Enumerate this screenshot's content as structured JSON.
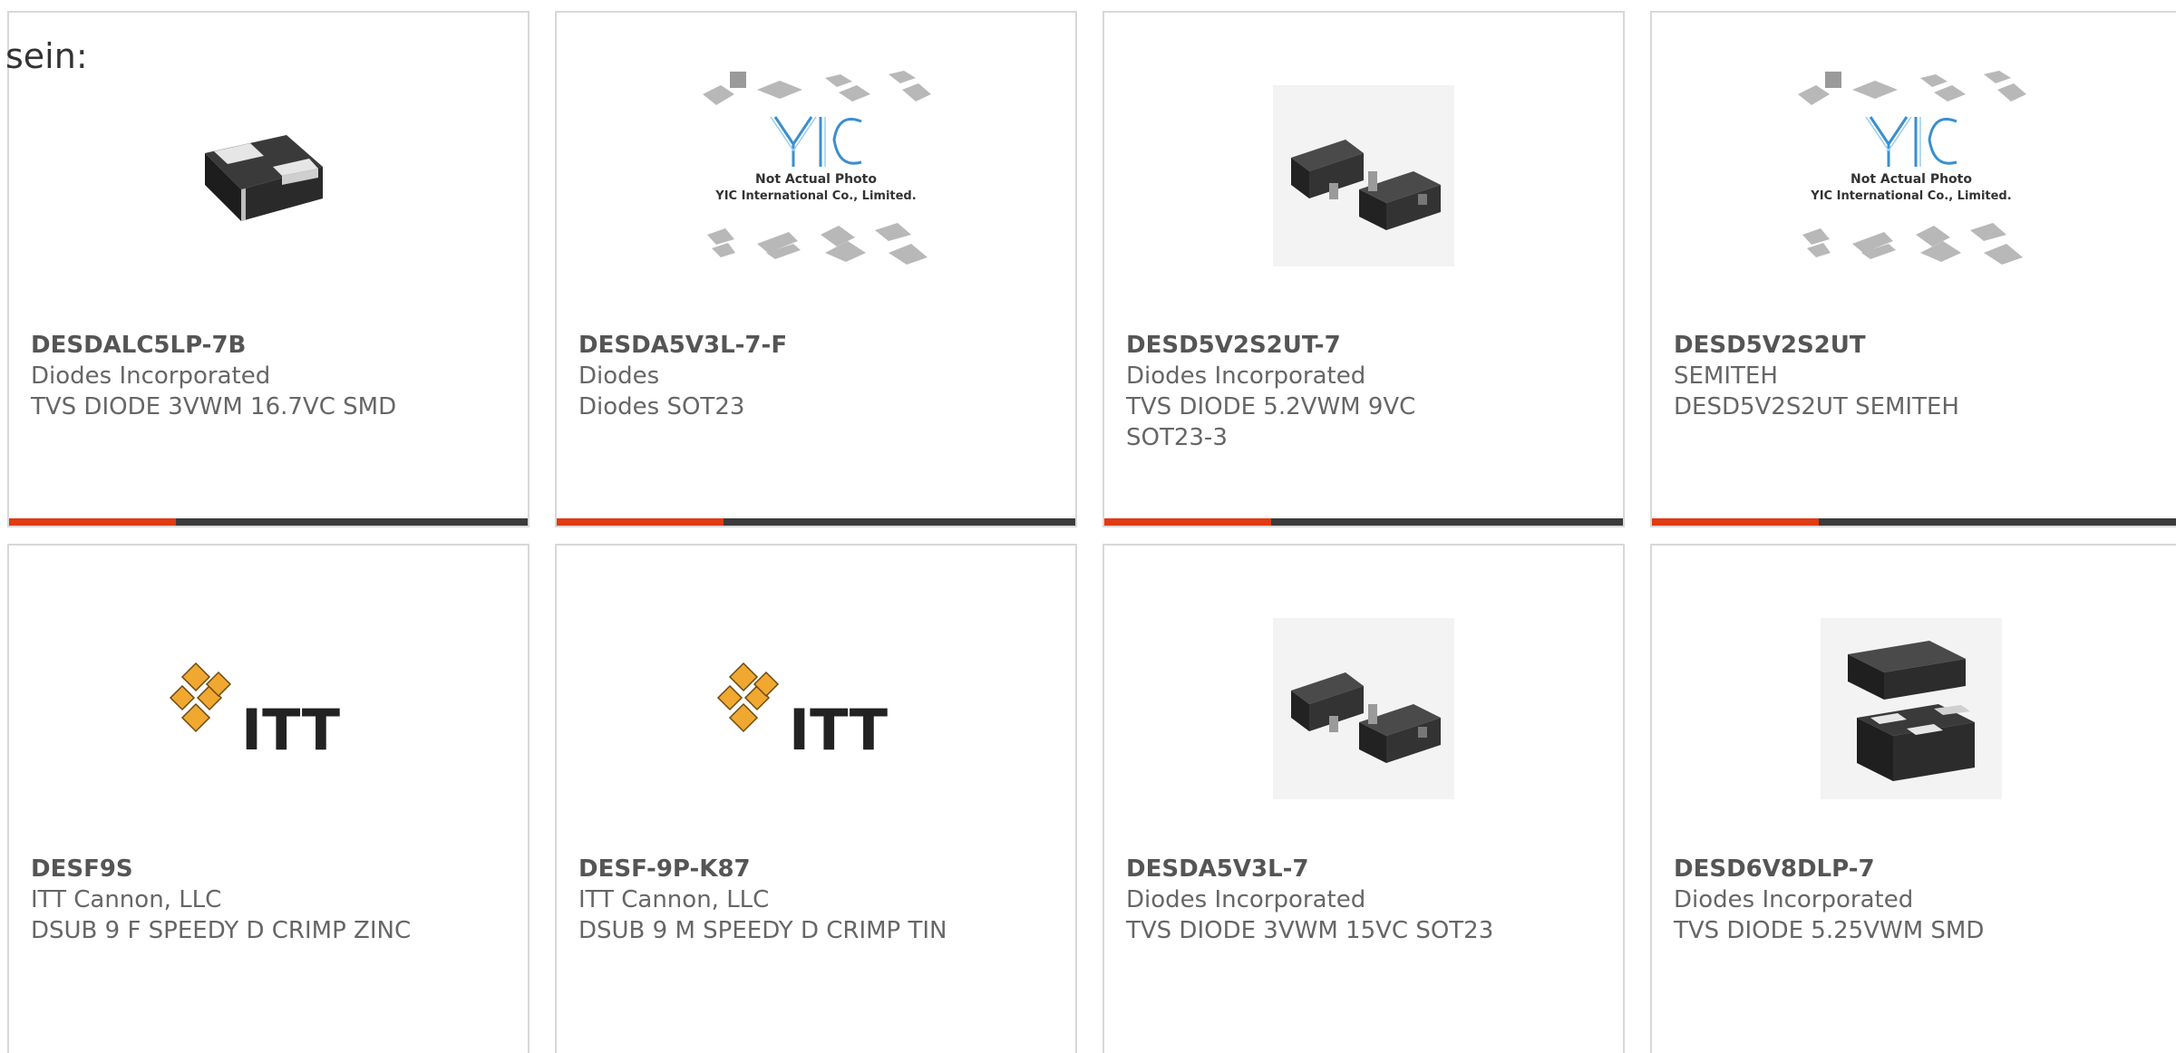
{
  "intro_text": "sein:",
  "colors": {
    "accent": "#e03b12",
    "bar_dark": "#3b3b3b",
    "card_border": "#d8d8d8",
    "itt_logo": "#f0a830"
  },
  "cards": [
    {
      "part": "DESDALC5LP-7B",
      "manufacturer": "Diodes Incorporated",
      "description": "TVS DIODE 3VWM 16.7VC SMD",
      "image": "chip-2pin-icon"
    },
    {
      "part": "DESDA5V3L-7-F",
      "manufacturer": "Diodes",
      "description": "Diodes SOT23",
      "image": "yic-placeholder",
      "placeholder": {
        "line1": "Not Actual Photo",
        "line2": "YIC International Co., Limited.",
        "logo": "YIC"
      }
    },
    {
      "part": "DESD5V2S2UT-7",
      "manufacturer": "Diodes Incorporated",
      "description": "TVS DIODE 5.2VWM 9VC SOT23-3",
      "image": "sot23-icon"
    },
    {
      "part": "DESD5V2S2UT",
      "manufacturer": "SEMITEH",
      "description": "DESD5V2S2UT SEMITEH",
      "image": "yic-placeholder",
      "placeholder": {
        "line1": "Not Actual Photo",
        "line2": "YIC International Co., Limited.",
        "logo": "YIC"
      }
    },
    {
      "part": "DESF9S",
      "manufacturer": "ITT Cannon, LLC",
      "description": "DSUB 9 F SPEEDY D CRIMP ZINC",
      "image": "itt-logo",
      "logo_text": "ITT"
    },
    {
      "part": "DESF-9P-K87",
      "manufacturer": "ITT Cannon, LLC",
      "description": "DSUB 9 M SPEEDY D CRIMP TIN",
      "image": "itt-logo",
      "logo_text": "ITT"
    },
    {
      "part": "DESDA5V3L-7",
      "manufacturer": "Diodes Incorporated",
      "description": "TVS DIODE 3VWM 15VC SOT23",
      "image": "sot23-icon"
    },
    {
      "part": "DESD6V8DLP-7",
      "manufacturer": "Diodes Incorporated",
      "description": "TVS DIODE 5.25VWM SMD",
      "image": "dfn-chip-icon"
    }
  ]
}
